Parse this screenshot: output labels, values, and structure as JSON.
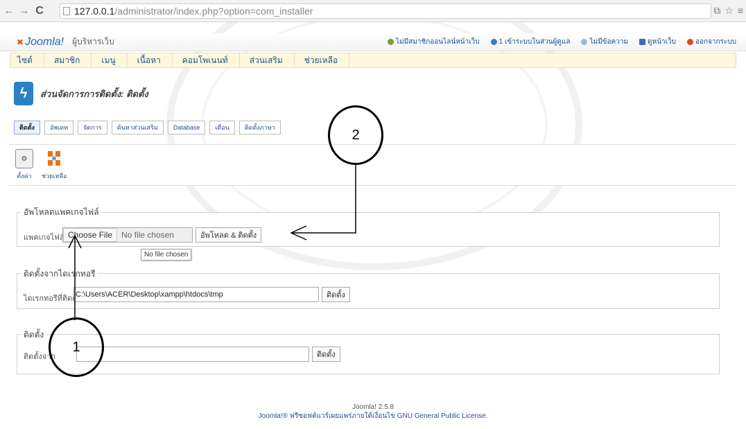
{
  "browser": {
    "url_host": "127.0.0.1",
    "url_path": "/administrator/index.php?option=com_installer"
  },
  "topbar": {
    "logo": "Joomla!",
    "site_name": "ผู้บริหารเว็บ",
    "status": [
      "ไม่มีสมาชิกออนไลน์หน้าเว็บ",
      "1 เข้าระบบในส่วนผู้ดูแล",
      "ไม่มีข้อความ",
      "ดูหน้าเว็บ",
      "ออกจากระบบ"
    ]
  },
  "menu": [
    "ไซต์",
    "สมาชิก",
    "เมนู",
    "เนื้อหา",
    "คอมโพเนนท์",
    "ส่วนเสริม",
    "ช่วยเหลือ"
  ],
  "header": {
    "title": "ส่วนจัดการการติดตั้ง: ติดตั้ง"
  },
  "tabs": [
    "ติดตั้ง",
    "อัพเดท",
    "จัดการ",
    "ค้นหาส่วนเสริม",
    "Database",
    "เตือน",
    "ติดตั้งภาษา"
  ],
  "toolbar": {
    "options_label": "ตั้งค่า",
    "help_label": "ช่วยเหลือ"
  },
  "upload_panel": {
    "legend": "อัพโหลดแพคเกจไฟล์",
    "label": "แพคเกจไฟล์",
    "choose_label": "Choose File",
    "file_state": "No file chosen",
    "submit_label": "อัพโหลด & ติดตั้ง",
    "tooltip": "No file chosen"
  },
  "directory_panel": {
    "legend": "ติดตั้งจากไดเรกทอรี",
    "label": "ไดเรกทอรีที่ติดตั้ง",
    "value": "C:\\Users\\ACER\\Desktop\\xampp\\htdocs\\tmp",
    "submit_label": "ติดตั้ง"
  },
  "url_panel": {
    "legend": "ติดตั้ง",
    "label": "ติดตั้งจาก",
    "submit_label": "ติดตั้ง"
  },
  "footer": {
    "version": "Joomla! 2.5.8",
    "license": "Joomla!® ฟรีซอฟต์แวร์เผยแพร่ภายใต้เงื่อนไข GNU General Public License."
  },
  "callouts": {
    "one": "1",
    "two": "2"
  },
  "colors": {
    "menu_bg": "#fbf8dc",
    "link": "#2a4f8c",
    "brand": "#1d67b0"
  }
}
